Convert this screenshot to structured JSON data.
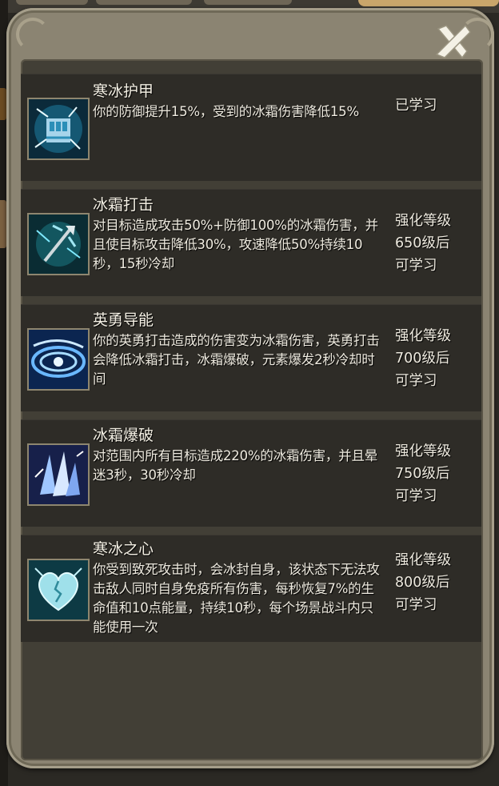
{
  "dialog": {
    "close_icon": "close-x-icon"
  },
  "skills": [
    {
      "name": "寒冰护甲",
      "description": "你的防御提升15%，受到的冰霜伤害降低15%",
      "status": "已学习",
      "icon": "frost-armor-fist-icon"
    },
    {
      "name": "冰霜打击",
      "description": "对目标造成攻击50%+防御100%的冰霜伤害，并且使目标攻击降低30%，攻速降低50%持续10秒，15秒冷却",
      "status": "强化等级\n650级后\n可学习",
      "icon": "frost-strike-trident-icon"
    },
    {
      "name": "英勇导能",
      "description": "你的英勇打击造成的伤害变为冰霜伤害，英勇打击会降低冰霜打击，冰霜爆破，元素爆发2秒冷却时间",
      "status": "强化等级\n700级后\n可学习",
      "icon": "frost-swirl-icon"
    },
    {
      "name": "冰霜爆破",
      "description": "对范围内所有目标造成220%的冰霜伤害，并且晕迷3秒，30秒冷却",
      "status": "强化等级\n750级后\n可学习",
      "icon": "ice-shards-icon"
    },
    {
      "name": "寒冰之心",
      "description": "你受到致死攻击时，会冰封自身，该状态下无法攻击敌人同时自身免疫所有伤害，每秒恢复7%的生命值和10点能量，持续10秒，每个场景战斗内只能使用一次",
      "status": "强化等级\n800级后\n可学习",
      "icon": "frozen-heart-icon"
    }
  ]
}
